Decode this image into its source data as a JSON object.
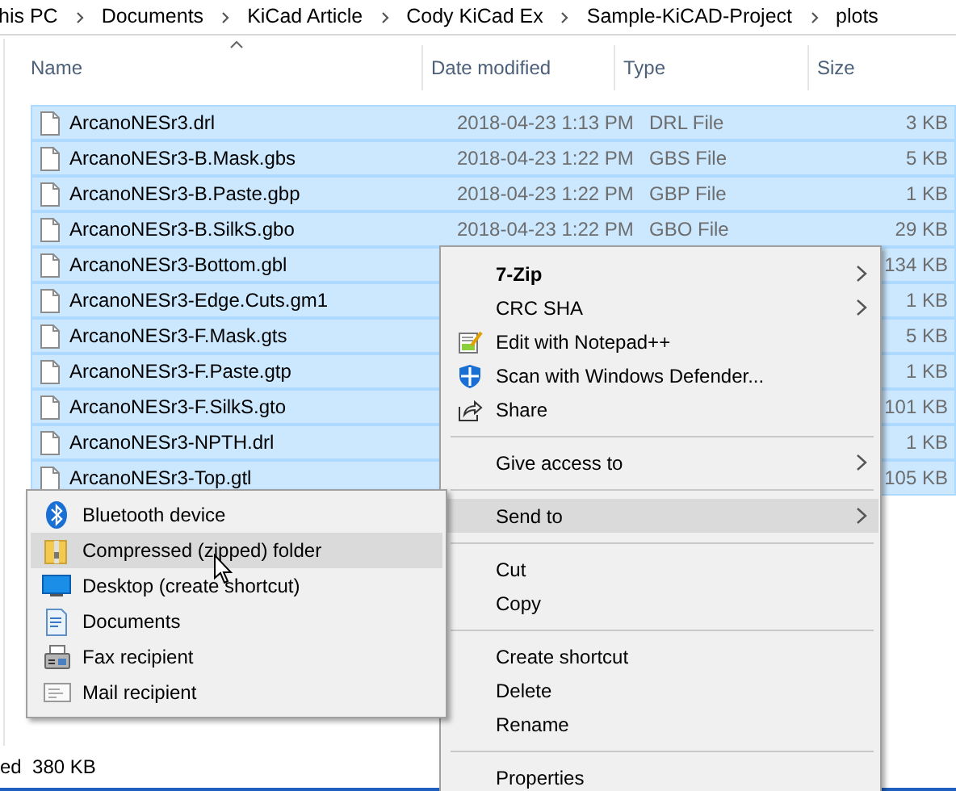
{
  "breadcrumb": [
    "his PC",
    "Documents",
    "KiCad Article",
    "Cody KiCad Ex",
    "Sample-KiCAD-Project",
    "plots"
  ],
  "columns": [
    {
      "label": "Name",
      "sorted": true
    },
    {
      "label": "Date modified",
      "sorted": false
    },
    {
      "label": "Type",
      "sorted": false
    },
    {
      "label": "Size",
      "sorted": false
    }
  ],
  "rows": [
    {
      "name": "ArcanoNESr3.drl",
      "date": "2018-04-23 1:13 PM",
      "type": "DRL File",
      "size": "3 KB",
      "selected": true
    },
    {
      "name": "ArcanoNESr3-B.Mask.gbs",
      "date": "2018-04-23 1:22 PM",
      "type": "GBS File",
      "size": "5 KB",
      "selected": true
    },
    {
      "name": "ArcanoNESr3-B.Paste.gbp",
      "date": "2018-04-23 1:22 PM",
      "type": "GBP File",
      "size": "1 KB",
      "selected": true
    },
    {
      "name": "ArcanoNESr3-B.SilkS.gbo",
      "date": "2018-04-23 1:22 PM",
      "type": "GBO File",
      "size": "29 KB",
      "selected": true
    },
    {
      "name": "ArcanoNESr3-Bottom.gbl",
      "size": "134 KB",
      "selected": true
    },
    {
      "name": "ArcanoNESr3-Edge.Cuts.gm1",
      "size": "1 KB",
      "selected": true
    },
    {
      "name": "ArcanoNESr3-F.Mask.gts",
      "size": "5 KB",
      "selected": true
    },
    {
      "name": "ArcanoNESr3-F.Paste.gtp",
      "size": "1 KB",
      "selected": true
    },
    {
      "name": "ArcanoNESr3-F.SilkS.gto",
      "size": "101 KB",
      "selected": true
    },
    {
      "name": "ArcanoNESr3-NPTH.drl",
      "size": "1 KB",
      "selected": true
    },
    {
      "name": "ArcanoNESr3-Top.gtl",
      "size": "105 KB",
      "selected": true
    }
  ],
  "context_menu": {
    "items": [
      {
        "kind": "item",
        "label": "7-Zip",
        "bold": true,
        "submenu": true,
        "selected": false
      },
      {
        "kind": "item",
        "label": "CRC SHA",
        "bold": false,
        "submenu": true,
        "selected": false
      },
      {
        "kind": "item",
        "label": "Edit with Notepad++",
        "bold": false,
        "submenu": false,
        "selected": false
      },
      {
        "kind": "item",
        "label": "Scan with Windows Defender...",
        "bold": false,
        "submenu": false,
        "selected": false
      },
      {
        "kind": "item",
        "label": "Share",
        "bold": false,
        "submenu": false,
        "selected": false
      },
      {
        "kind": "separator"
      },
      {
        "kind": "item",
        "label": "Give access to",
        "bold": false,
        "submenu": true,
        "selected": false
      },
      {
        "kind": "separator"
      },
      {
        "kind": "item",
        "label": "Send to",
        "bold": false,
        "submenu": true,
        "selected": true
      },
      {
        "kind": "separator"
      },
      {
        "kind": "item",
        "label": "Cut",
        "bold": false,
        "submenu": false,
        "selected": false
      },
      {
        "kind": "item",
        "label": "Copy",
        "bold": false,
        "submenu": false,
        "selected": false
      },
      {
        "kind": "separator"
      },
      {
        "kind": "item",
        "label": "Create shortcut",
        "bold": false,
        "submenu": false,
        "selected": false
      },
      {
        "kind": "item",
        "label": "Delete",
        "bold": false,
        "submenu": false,
        "selected": false
      },
      {
        "kind": "item",
        "label": "Rename",
        "bold": false,
        "submenu": false,
        "selected": false
      },
      {
        "kind": "separator"
      },
      {
        "kind": "item",
        "label": "Properties",
        "bold": false,
        "submenu": false,
        "selected": false
      }
    ]
  },
  "send_to_menu": {
    "items": [
      {
        "label": "Bluetooth device",
        "selected": false
      },
      {
        "label": "Compressed (zipped) folder",
        "selected": true
      },
      {
        "label": "Desktop (create shortcut)",
        "selected": false
      },
      {
        "label": "Documents",
        "selected": false
      },
      {
        "label": "Fax recipient",
        "selected": false
      },
      {
        "label": "Mail recipient",
        "selected": false
      }
    ]
  },
  "status_bar": {
    "text": "ed  380 KB"
  }
}
